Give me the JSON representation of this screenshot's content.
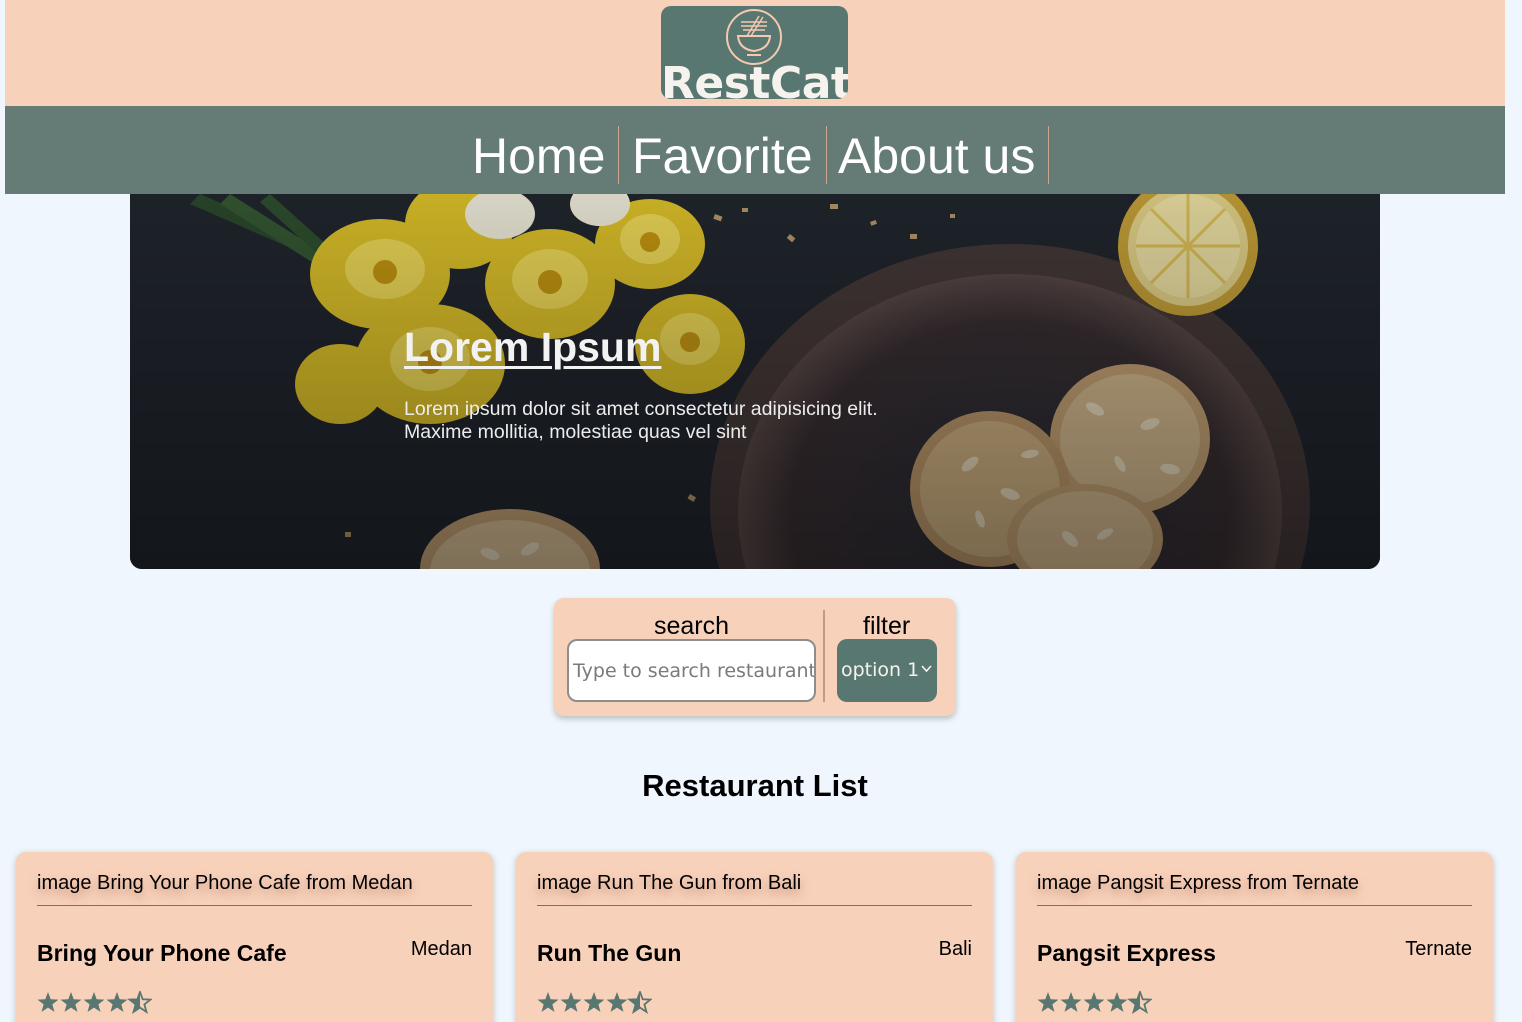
{
  "header": {
    "logo_text": "RestCat"
  },
  "nav": {
    "items": [
      {
        "label": "Home"
      },
      {
        "label": "Favorite"
      },
      {
        "label": "About us"
      }
    ]
  },
  "hero": {
    "title": "Lorem Ipsum",
    "description": "Lorem ipsum dolor sit amet consectetur adipisicing elit. Maxime mollitia, molestiae quas vel sint"
  },
  "search": {
    "label": "search",
    "placeholder": "Type to search restaurant",
    "value": ""
  },
  "filter": {
    "label": "filter",
    "selected": "option 1"
  },
  "restaurant_list": {
    "title": "Restaurant List",
    "items": [
      {
        "image_alt": "image Bring Your Phone Cafe from Medan",
        "name": "Bring Your Phone Cafe",
        "city": "Medan",
        "rating": 4.5
      },
      {
        "image_alt": "image Run The Gun from Bali",
        "name": "Run The Gun",
        "city": "Bali",
        "rating": 4.5
      },
      {
        "image_alt": "image Pangsit Express from Ternate",
        "name": "Pangsit Express",
        "city": "Ternate",
        "rating": 4.5
      }
    ]
  },
  "colors": {
    "header_bg": "#f8d1bb",
    "nav_bg": "#657c76",
    "accent": "#587770",
    "page_bg": "#eff6fd"
  },
  "icons": {
    "logo": "ramen-bowl-icon",
    "star": "star-icon",
    "half_star": "half-star-icon",
    "dropdown": "chevron-down-icon"
  }
}
